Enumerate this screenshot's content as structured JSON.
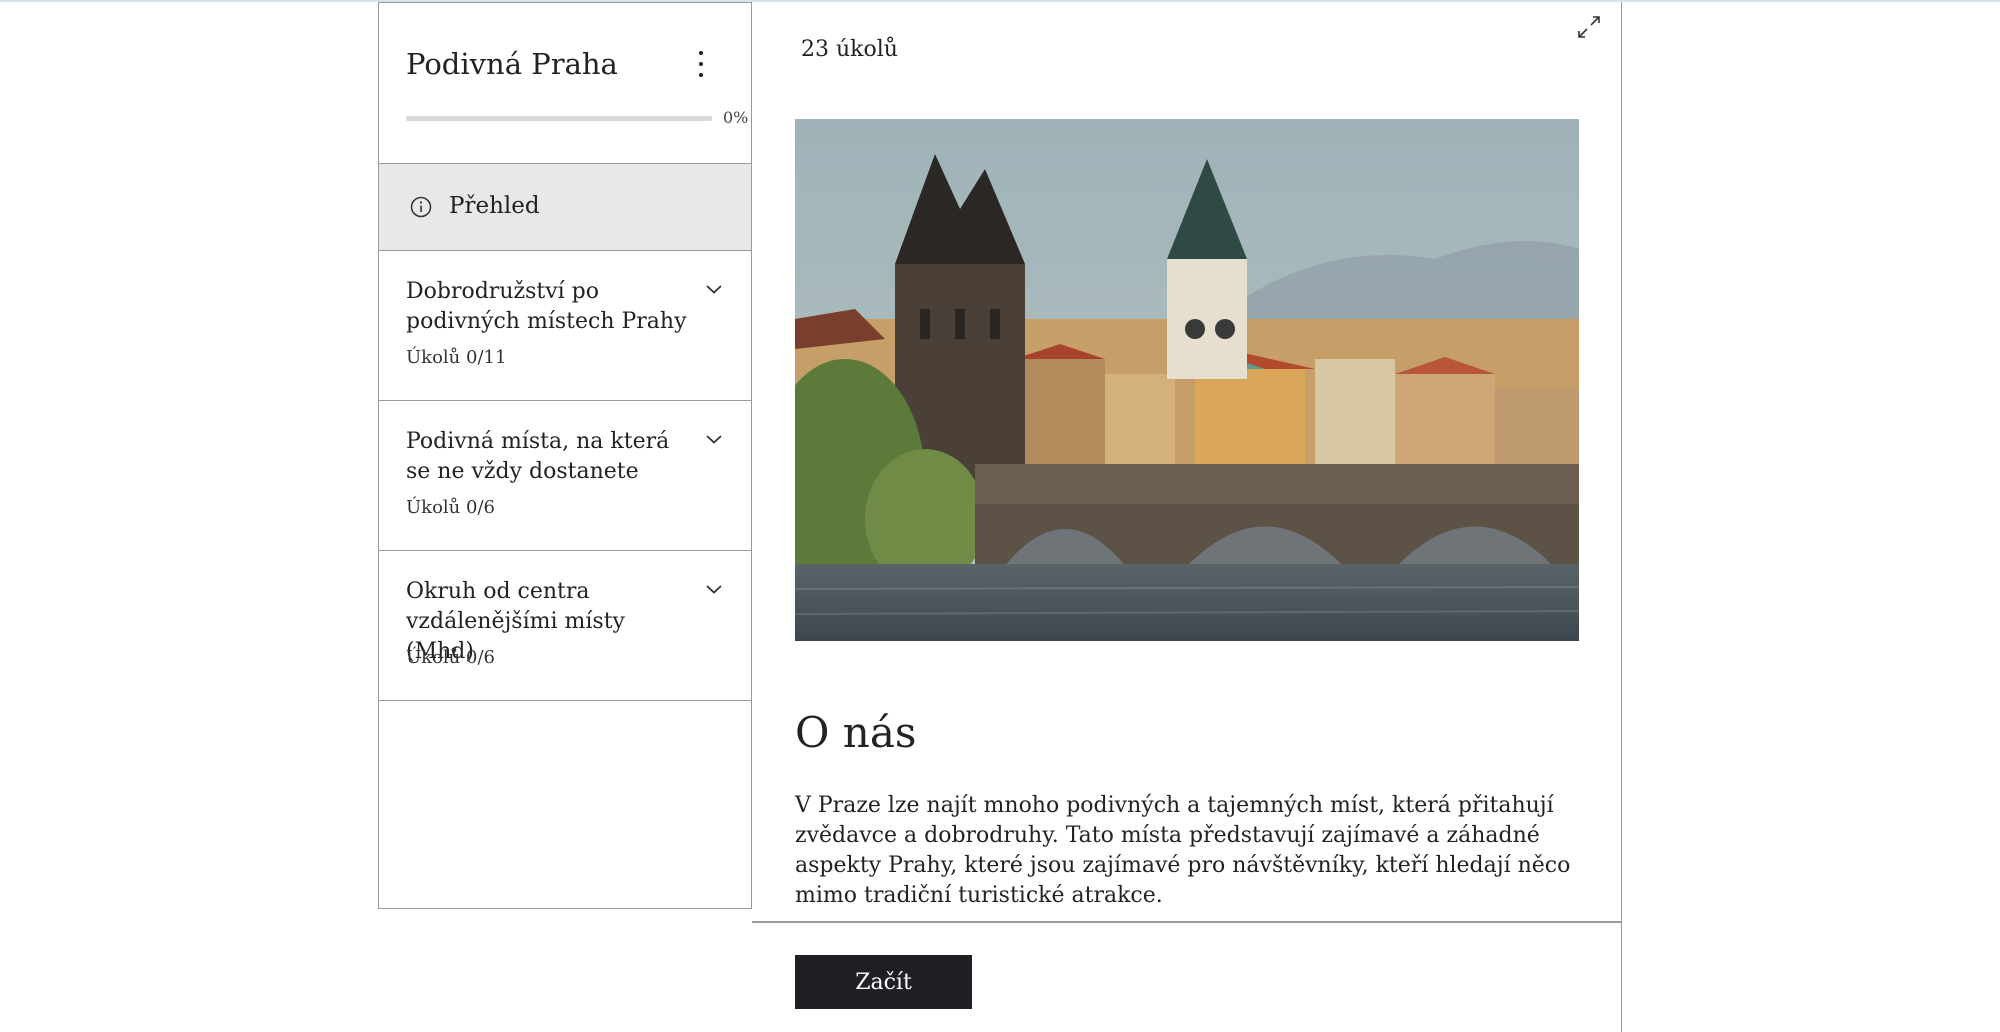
{
  "sidebar": {
    "title": "Podivná Praha",
    "progress": {
      "percent_label": "0%",
      "value": 0
    },
    "overview_label": "Přehled",
    "sections": [
      {
        "title": "Dobrodružství po podivných místech Prahy",
        "count": "Úkolů 0/11"
      },
      {
        "title": "Podivná místa, na která se ne vždy dostanete",
        "count": "Úkolů 0/6"
      },
      {
        "title": "Okruh od centra vzdálenějšími místy (Mhd)",
        "count": "Úkolů 0/6"
      }
    ]
  },
  "main": {
    "task_count": "23 úkolů",
    "about_heading": "O nás",
    "about_text": "V Praze lze najít mnoho podivných a tajemných míst, která přitahují zvědavce a dobrodruhy. Tato místa představují zajímavé a záhadné aspekty Prahy, které jsou zajímavé pro návštěvníky, kteří hledají něco mimo tradiční turistické atrakce.",
    "start_label": "Začít"
  },
  "icons": {
    "menu": "kebab-menu-icon",
    "info": "info-icon",
    "chevron": "chevron-down-icon",
    "expand": "expand-icon"
  },
  "colors": {
    "button_bg": "#1f2023",
    "overview_bg": "#e8e8e8",
    "border": "#9a9a9a"
  }
}
